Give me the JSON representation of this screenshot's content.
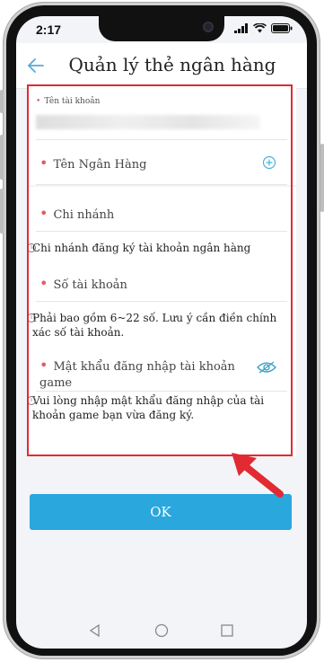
{
  "statusbar": {
    "time": "2:17"
  },
  "header": {
    "title": "Quản lý thẻ ngân hàng"
  },
  "form": {
    "account_name": {
      "label": "Tên tài khoản",
      "value_blurred": true
    },
    "bank_name": {
      "label": "Tên Ngân Hàng",
      "action_icon": "plus-circle-icon"
    },
    "branch": {
      "label": "Chi nhánh",
      "hint": "Chi nhánh đăng ký tài khoản ngân hàng"
    },
    "account_number": {
      "label": "Số tài khoản",
      "hint": "Phải bao gồm 6~22 số. Lưu ý cần điền chính xác số tài khoản."
    },
    "password": {
      "label": "Mật khẩu đăng nhập tài khoản game",
      "action_icon": "eye-icon",
      "hint": "Vui lòng nhập mật khẩu đăng nhập của tài khoản game bạn vừa đăng ký."
    }
  },
  "ok_button": {
    "label": "OK"
  },
  "colors": {
    "accent": "#2aa7dc",
    "annotation": "#e22a32",
    "required_star": "#e35d5d"
  }
}
